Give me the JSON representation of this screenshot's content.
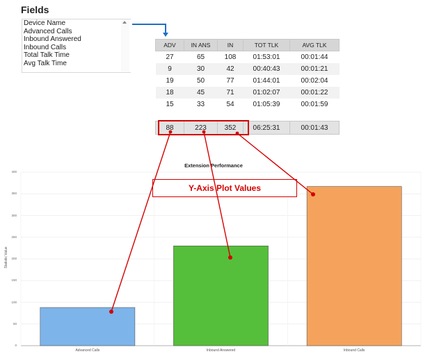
{
  "fields": {
    "title": "Fields",
    "items": [
      "Device Name",
      "Advanced Calls",
      "Inbound Answered",
      "Inbound Calls",
      "Total Talk Time",
      "Avg Talk Time"
    ]
  },
  "table": {
    "headers": [
      "ADV",
      "IN ANS",
      "IN",
      "TOT TLK",
      "AVG TLK"
    ],
    "rows": [
      [
        "27",
        "65",
        "108",
        "01:53:01",
        "00:01:44"
      ],
      [
        "9",
        "30",
        "42",
        "00:40:43",
        "00:01:21"
      ],
      [
        "19",
        "50",
        "77",
        "01:44:01",
        "00:02:04"
      ],
      [
        "18",
        "45",
        "71",
        "01:02:07",
        "00:01:22"
      ],
      [
        "15",
        "33",
        "54",
        "01:05:39",
        "00:01:59"
      ]
    ],
    "totals": [
      "88",
      "223",
      "352",
      "06:25:31",
      "00:01:43"
    ]
  },
  "annotation": {
    "label": "Y-Axis Plot Values",
    "color": "#d40000"
  },
  "connector_color": "#1f6fc2",
  "chart_data": {
    "type": "bar",
    "title": "Extension Performance",
    "ylabel": "Statistic Value",
    "xlabel": "",
    "categories": [
      "Advanced Calls",
      "Inbound Answered",
      "Inbound Calls"
    ],
    "values": [
      88,
      230,
      367
    ],
    "colors": [
      "#7db4ea",
      "#55bf3b",
      "#f5a35c"
    ],
    "ylim": [
      0,
      400
    ],
    "yticks": [
      "0",
      "50",
      "100",
      "150",
      "200",
      "250",
      "300",
      "350",
      "400"
    ],
    "grid": true
  }
}
